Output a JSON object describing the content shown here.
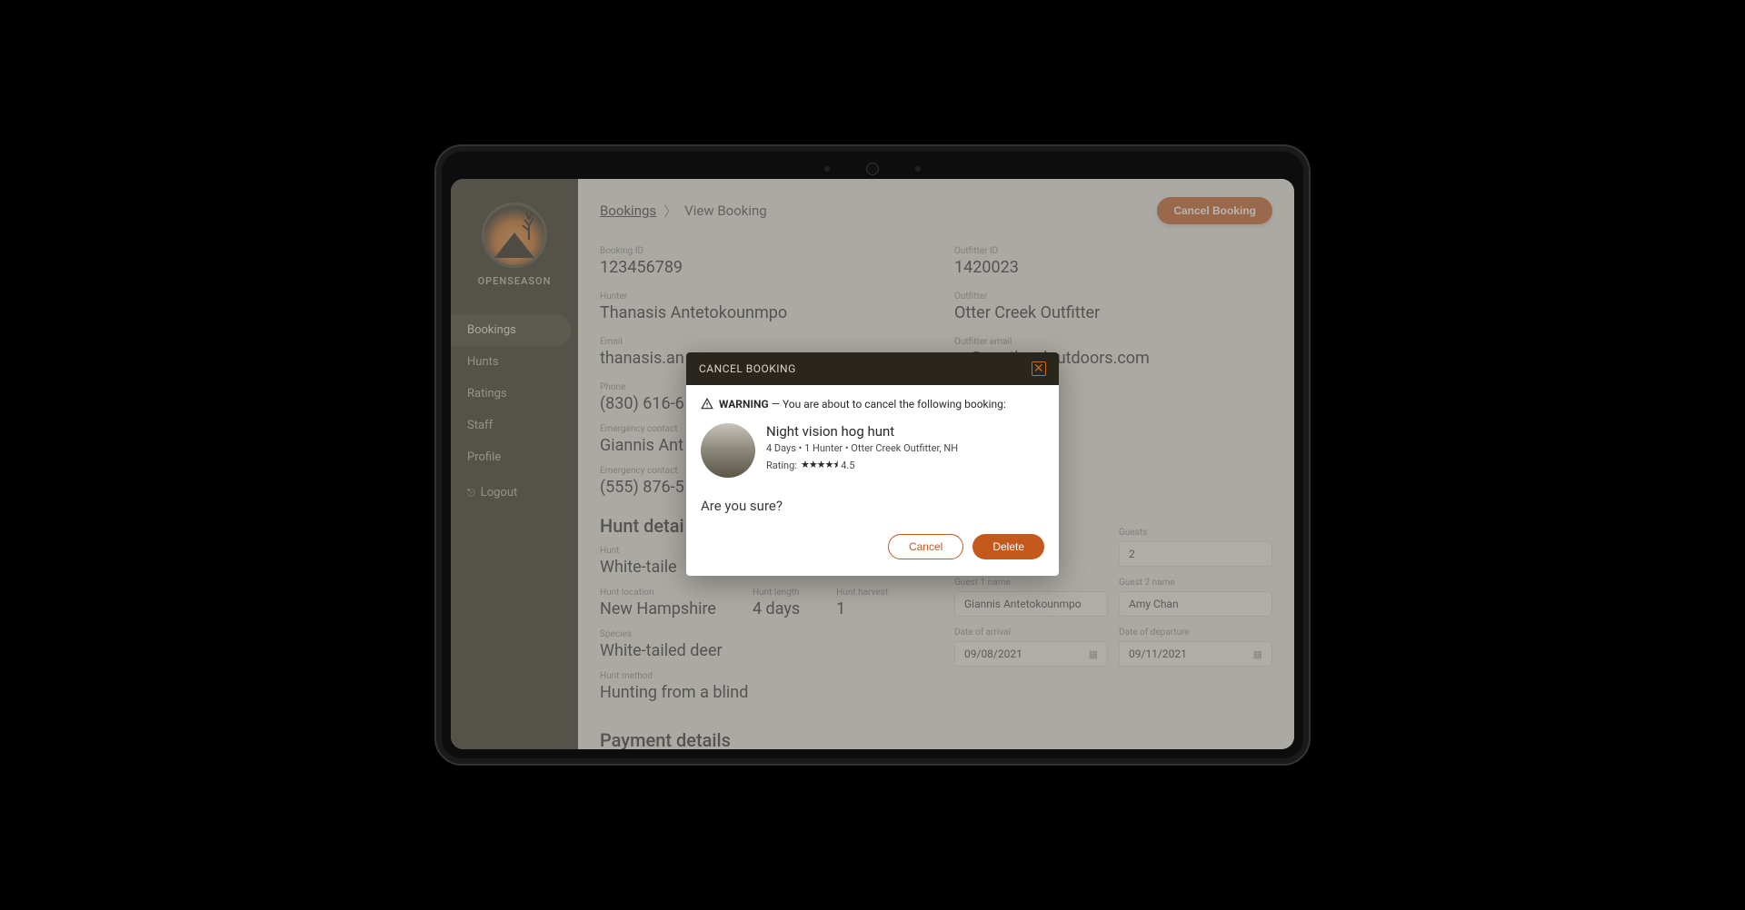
{
  "brand": "OPENSEASON",
  "nav": {
    "items": [
      {
        "label": "Bookings",
        "active": true
      },
      {
        "label": "Hunts"
      },
      {
        "label": "Ratings"
      },
      {
        "label": "Staff"
      },
      {
        "label": "Profile"
      }
    ],
    "logout": "Logout"
  },
  "breadcrumb": {
    "root": "Bookings",
    "current": "View Booking"
  },
  "header_button": "Cancel Booking",
  "booking": {
    "booking_id_label": "Booking ID",
    "booking_id": "123456789",
    "outfitter_id_label": "Outfitter ID",
    "outfitter_id": "1420023",
    "hunter_label": "Hunter",
    "hunter": "Thanasis Antetokounmpo",
    "outfitter_label": "Outfitter",
    "outfitter": "Otter Creek Outfitter",
    "email_label": "Email",
    "email": "thanasis.an",
    "outfitter_email_label": "Outfitter email",
    "outfitter_email": "er@nextleveloutdoors.com",
    "phone_label": "Phone",
    "phone": "(830) 616-6",
    "emergency_name_label": "Emergency contact",
    "emergency_name": "Giannis Ant",
    "emergency_phone_label": "Emergency contact",
    "emergency_phone": "(555) 876-5"
  },
  "hunt": {
    "section_title": "Hunt detai",
    "hunt_label": "Hunt",
    "hunt_name": "White-taile",
    "location_label": "Hunt location",
    "location": "New Hampshire",
    "length_label": "Hunt length",
    "length": "4 days",
    "harvest_label": "Hunt harvest",
    "harvest": "1",
    "species_label": "Species",
    "species": "White-tailed deer",
    "method_label": "Hunt method",
    "method": "Hunting from a blind",
    "payment_title": "Payment details"
  },
  "form": {
    "guests_label": "Guests",
    "guests": "2",
    "guest1_label": "Guest 1 name",
    "guest1": "Giannis Antetokounmpo",
    "guest2_label": "Guest 2 name",
    "guest2": "Amy Chan",
    "arrival_label": "Date of arrival",
    "arrival": "09/08/2021",
    "departure_label": "Date of departure",
    "departure": "09/11/2021"
  },
  "modal": {
    "title": "CANCEL BOOKING",
    "warning_prefix": "WARNING",
    "warning_text": " — You are about to cancel the following booking:",
    "hunt_title": "Night vision hog hunt",
    "hunt_meta": "4 Days • 1 Hunter • Otter Creek Outfitter, NH",
    "rating_label": "Rating:",
    "rating_stars": "★★★★⯨",
    "rating_value": "4.5",
    "confirm": "Are you sure?",
    "cancel_btn": "Cancel",
    "delete_btn": "Delete"
  }
}
